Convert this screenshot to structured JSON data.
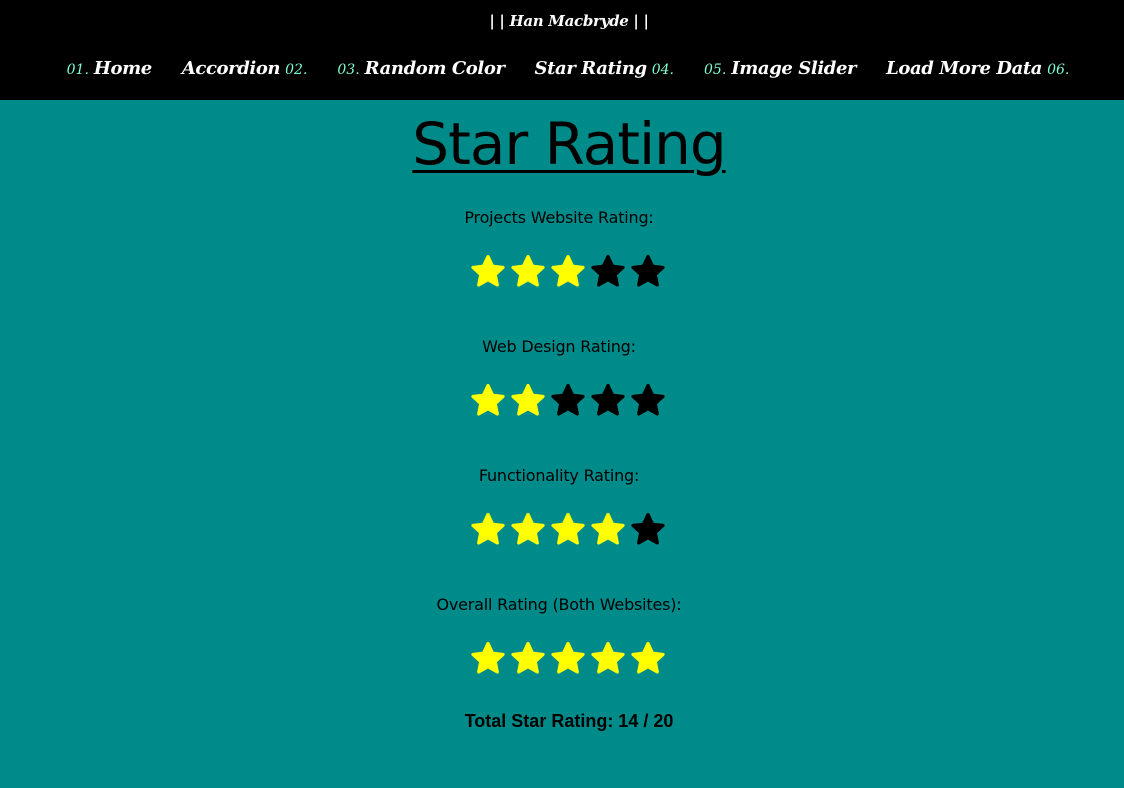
{
  "header": {
    "brand": "| | Han Macbryde | |"
  },
  "nav": [
    {
      "number": "01.",
      "label": "Home",
      "num_position": "before"
    },
    {
      "number": "02.",
      "label": "Accordion",
      "num_position": "after"
    },
    {
      "number": "03.",
      "label": "Random Color",
      "num_position": "before"
    },
    {
      "number": "04.",
      "label": "Star Rating",
      "num_position": "after"
    },
    {
      "number": "05.",
      "label": "Image Slider",
      "num_position": "before"
    },
    {
      "number": "06.",
      "label": "Load More Data",
      "num_position": "after"
    }
  ],
  "page": {
    "title": "Star Rating"
  },
  "ratings": [
    {
      "label": "Projects Website Rating:",
      "filled": 3,
      "max": 5
    },
    {
      "label": "Web Design Rating:",
      "filled": 2,
      "max": 5
    },
    {
      "label": "Functionality Rating:",
      "filled": 4,
      "max": 5
    },
    {
      "label": "Overall Rating (Both Websites):",
      "filled": 5,
      "max": 5
    }
  ],
  "total": {
    "text": "Total Star Rating: 14 / 20"
  },
  "colors": {
    "background": "#008b8b",
    "topbar": "#000000",
    "nav_number": "#7fffd4",
    "star_filled": "#ffff00",
    "star_empty": "#000000"
  }
}
